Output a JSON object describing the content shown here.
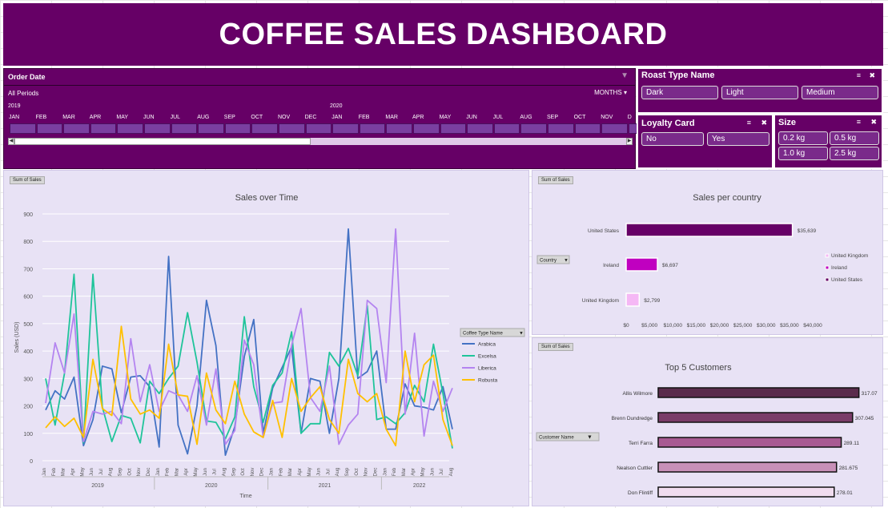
{
  "title": "COFFEE SALES DASHBOARD",
  "timeline": {
    "header": "Order Date",
    "period": "All Periods",
    "unit": "MONTHS",
    "years": [
      "2019",
      "2020"
    ],
    "months": [
      "JAN",
      "FEB",
      "MAR",
      "APR",
      "MAY",
      "JUN",
      "JUL",
      "AUG",
      "SEP",
      "OCT",
      "NOV",
      "DEC",
      "JAN",
      "FEB",
      "MAR",
      "APR",
      "MAY",
      "JUN",
      "JUL",
      "AUG",
      "SEP",
      "OCT",
      "NOV",
      "D"
    ]
  },
  "slicers": {
    "roast": {
      "title": "Roast Type Name",
      "items": [
        "Dark",
        "Light",
        "Medium"
      ]
    },
    "loyalty": {
      "title": "Loyalty Card",
      "items": [
        "No",
        "Yes"
      ]
    },
    "size": {
      "title": "Size",
      "items": [
        "0.2 kg",
        "0.5 kg",
        "1.0 kg",
        "2.5 kg"
      ]
    }
  },
  "colors": {
    "purple": "#660066",
    "panel": "#e8e2f5",
    "arabica": "#4472c4",
    "excelsa": "#1fc49a",
    "liberica": "#b484f0",
    "robusta": "#ffc000"
  },
  "chart_data": [
    {
      "type": "line",
      "title": "Sales over Time",
      "field_button": "Sum of Sales",
      "xlabel": "Time",
      "ylabel": "Sales (USD)",
      "ylim": [
        0,
        900
      ],
      "yticks": [
        "0",
        "100",
        "200",
        "300",
        "400",
        "500",
        "600",
        "700",
        "800",
        "900"
      ],
      "legend_title": "Coffee Type Name",
      "legend_position": "right",
      "grid": true,
      "months": [
        "Jan",
        "Feb",
        "Mar",
        "Apr",
        "May",
        "Jun",
        "Jul",
        "Aug",
        "Sep",
        "Oct",
        "Nov",
        "Dec",
        "Jan",
        "Feb",
        "Mar",
        "Apr",
        "May",
        "Jun",
        "Jul",
        "Aug",
        "Sep",
        "Oct",
        "Nov",
        "Dec",
        "Jan",
        "Feb",
        "Mar",
        "Apr",
        "May",
        "Jun",
        "Jul",
        "Aug",
        "Sep",
        "Oct",
        "Nov",
        "Dec",
        "Jan",
        "Feb",
        "Mar",
        "Apr",
        "May",
        "Jun",
        "Jul",
        "Aug"
      ],
      "years": [
        "2019",
        "2020",
        "2021",
        "2022"
      ],
      "series": [
        {
          "name": "Arabica",
          "values": [
            185,
            255,
            225,
            305,
            55,
            150,
            345,
            335,
            175,
            305,
            310,
            270,
            50,
            745,
            130,
            25,
            200,
            585,
            420,
            20,
            125,
            380,
            515,
            100,
            265,
            340,
            415,
            100,
            300,
            290,
            100,
            300,
            845,
            300,
            325,
            400,
            115,
            115,
            280,
            200,
            195,
            185,
            270,
            115
          ]
        },
        {
          "name": "Excelsa",
          "values": [
            300,
            130,
            320,
            680,
            65,
            680,
            195,
            70,
            165,
            155,
            65,
            290,
            245,
            300,
            345,
            540,
            360,
            145,
            140,
            80,
            160,
            525,
            270,
            140,
            275,
            320,
            470,
            100,
            135,
            135,
            395,
            345,
            410,
            310,
            565,
            150,
            160,
            135,
            175,
            275,
            215,
            425,
            245,
            45
          ]
        },
        {
          "name": "Liberica",
          "values": [
            210,
            430,
            320,
            535,
            70,
            180,
            170,
            180,
            135,
            445,
            215,
            350,
            180,
            255,
            240,
            180,
            310,
            130,
            335,
            60,
            110,
            440,
            350,
            85,
            210,
            215,
            420,
            555,
            230,
            180,
            345,
            60,
            130,
            170,
            585,
            555,
            285,
            845,
            170,
            465,
            90,
            290,
            180,
            265,
            15
          ]
        },
        {
          "name": "Robusta",
          "values": [
            120,
            160,
            125,
            155,
            85,
            370,
            190,
            165,
            490,
            225,
            170,
            185,
            155,
            425,
            240,
            235,
            60,
            320,
            185,
            135,
            290,
            170,
            105,
            85,
            220,
            85,
            300,
            180,
            230,
            270,
            150,
            100,
            370,
            245,
            215,
            245,
            115,
            55,
            400,
            215,
            350,
            385,
            150,
            55
          ]
        }
      ]
    },
    {
      "type": "bar",
      "title": "Sales per country",
      "field_button": "Sum of Sales",
      "filter_button": "Country",
      "categories": [
        "United States",
        "Ireland",
        "United Kingdom"
      ],
      "values": [
        35639,
        6697,
        2799
      ],
      "labels": [
        "$35,639",
        "$6,697",
        "$2,799"
      ],
      "xticks": [
        "$0",
        "$5,000",
        "$10,000",
        "$15,000",
        "$20,000",
        "$25,000",
        "$30,000",
        "$35,000",
        "$40,000"
      ],
      "xlim": [
        0,
        40000
      ],
      "bar_colors": [
        "#660066",
        "#c000c0",
        "#f5b8f5"
      ],
      "legend": [
        "United Kingdom",
        "Ireland",
        "United States"
      ]
    },
    {
      "type": "bar",
      "title": "Top 5 Customers",
      "field_button": "Sum of Sales",
      "filter_button": "Customer Name",
      "categories": [
        "Allis Wilmore",
        "Brenn Dundredge",
        "Terri Farra",
        "Nealson Cuttler",
        "Don Flintiff"
      ],
      "values": [
        317.07,
        307.045,
        289.11,
        281.675,
        278.01
      ],
      "labels": [
        "317.07",
        "307.045",
        "289.11",
        "281.675",
        "278.01"
      ],
      "bar_colors": [
        "#5a2c4c",
        "#7a3c68",
        "#a85a92",
        "#c890b8",
        "#f0dcef"
      ]
    }
  ]
}
